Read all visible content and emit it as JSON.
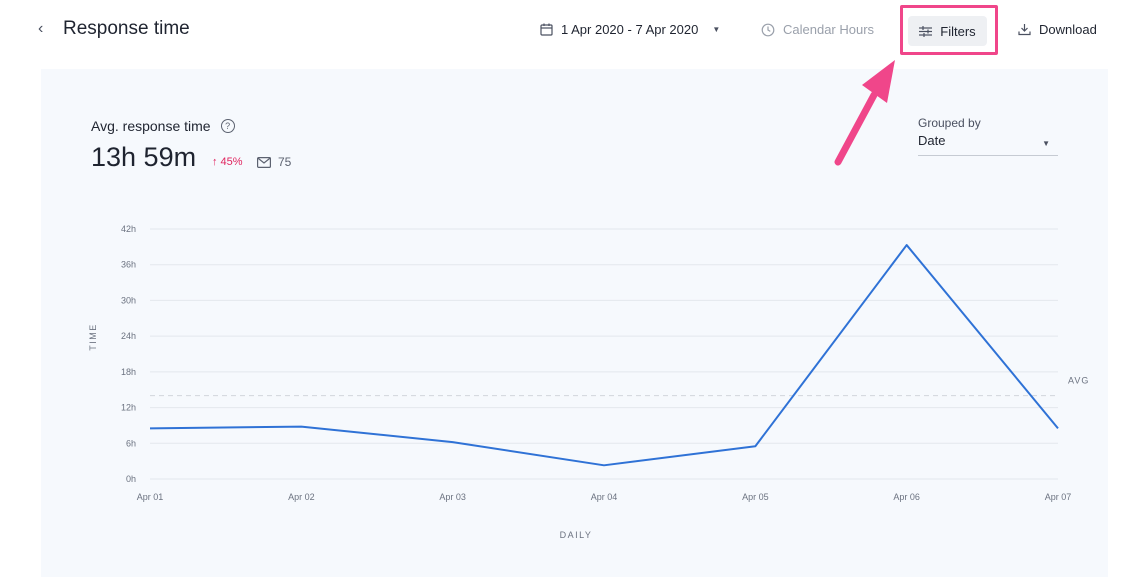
{
  "header": {
    "back_glyph": "‹",
    "title": "Response time",
    "date_range": "1 Apr 2020 - 7 Apr 2020",
    "calendar_hours": "Calendar Hours",
    "filters": "Filters",
    "download": "Download"
  },
  "metric": {
    "label": "Avg. response time",
    "value": "13h 59m",
    "delta": "↑ 45%",
    "message_count": "75"
  },
  "grouping": {
    "label": "Grouped by",
    "value": "Date"
  },
  "colors": {
    "line": "#2f72d6",
    "accent": "#f0468a",
    "delta": "#e0245e"
  },
  "chart_data": {
    "type": "line",
    "categories": [
      "Apr 01",
      "Apr 02",
      "Apr 03",
      "Apr 04",
      "Apr 05",
      "Apr 06",
      "Apr 07"
    ],
    "series": [
      {
        "values": [
          8.5,
          8.8,
          6.2,
          2.3,
          5.5,
          39.3,
          8.5
        ]
      }
    ],
    "average": 14,
    "average_label": "AVG",
    "yticks": [
      "0h",
      "6h",
      "12h",
      "18h",
      "24h",
      "30h",
      "36h",
      "42h"
    ],
    "ylim": [
      0,
      42
    ],
    "xlabel": "DAILY",
    "ylabel": "TIME"
  }
}
